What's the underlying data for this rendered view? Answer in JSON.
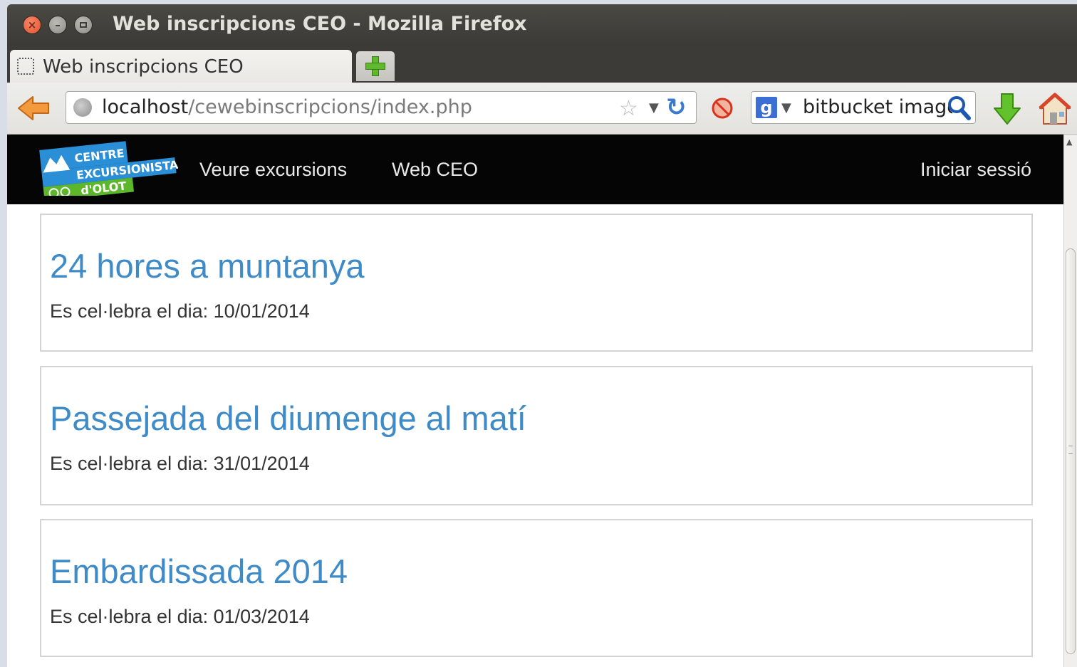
{
  "window": {
    "title": "Web inscripcions CEO - Mozilla Firefox"
  },
  "tabs": [
    {
      "label": "Web inscripcions CEO"
    }
  ],
  "navbar": {
    "url_host": "localhost",
    "url_path": "/cewebinscripcions/index.php",
    "search_value": "bitbucket image",
    "search_engine": "google-icon"
  },
  "site": {
    "logo_lines": [
      "CENTRE",
      "EXCURSIONISTA",
      "d'OLOT"
    ],
    "nav": {
      "excursions": "Veure excursions",
      "webceo": "Web CEO",
      "login": "Iniciar sessió"
    }
  },
  "excursions": [
    {
      "title": "24 hores a muntanya",
      "date_label": "Es cel·lebra el dia: 10/01/2014"
    },
    {
      "title": "Passejada del diumenge al matí",
      "date_label": "Es cel·lebra el dia: 31/01/2014"
    },
    {
      "title": "Embardissada 2014",
      "date_label": "Es cel·lebra el dia: 01/03/2014"
    }
  ],
  "colors": {
    "link_blue": "#3f8bc7",
    "nav_bg": "#050505"
  }
}
